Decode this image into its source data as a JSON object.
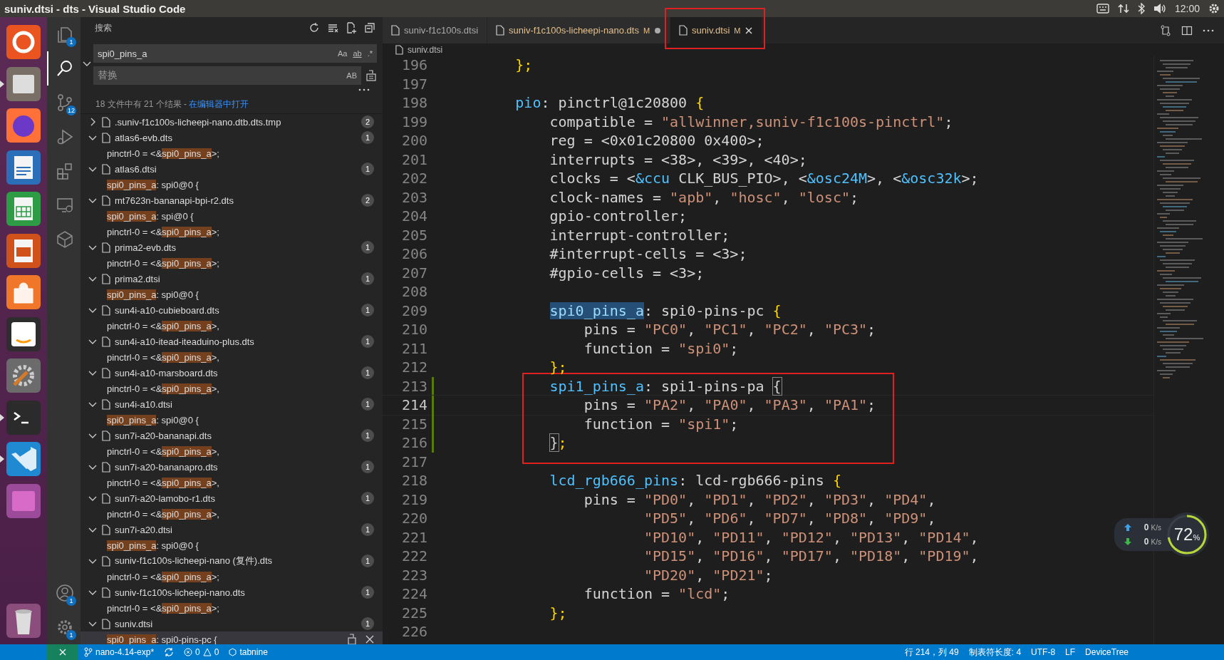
{
  "window": {
    "title": "suniv.dtsi - dts - Visual Studio Code"
  },
  "tray": {
    "time": "12:00"
  },
  "dock": [
    {
      "running": false
    },
    {
      "running": true
    },
    {
      "running": false
    },
    {
      "running": false
    },
    {
      "running": false
    },
    {
      "running": false
    },
    {
      "running": false
    },
    {
      "running": false
    },
    {
      "running": false
    },
    {
      "running": true
    },
    {
      "running": true
    },
    {
      "running": false
    }
  ],
  "activity_bar": [
    {
      "badge": "1",
      "selected": false
    },
    {
      "selected": true
    },
    {
      "badge": "12",
      "selected": false
    },
    {
      "selected": false
    },
    {
      "selected": false
    },
    {
      "selected": false
    },
    {
      "selected": false
    }
  ],
  "activity_bar_bottom": [
    {
      "badge": "1"
    },
    {
      "badge": "1"
    }
  ],
  "sidebar": {
    "title": "搜索",
    "search": {
      "value": "spi0_pins_a",
      "options": [
        "Aa",
        "ab",
        ".*"
      ]
    },
    "replace": {
      "placeholder": "替换",
      "options": [
        "AB"
      ]
    },
    "summary": "18 文件中有 21 个结果 - ",
    "summary_link": "在编辑器中打开",
    "files": [
      {
        "name": ".suniv-f1c100s-licheepi-nano.dtb.dts.tmp",
        "count": "2",
        "expanded": false
      },
      {
        "name": "atlas6-evb.dts",
        "count": "1",
        "expanded": true,
        "matches": [
          {
            "before": "pinctrl-0 = <&",
            "match": "spi0_pins_a",
            "after": ">;",
            "selected": false
          }
        ]
      },
      {
        "name": "atlas6.dtsi",
        "count": "1",
        "expanded": true,
        "matches": [
          {
            "match": "spi0_pins_a",
            "after": ": spi0@0 {",
            "selected": false
          }
        ]
      },
      {
        "name": "mt7623n-bananapi-bpi-r2.dts",
        "count": "2",
        "expanded": true,
        "matches": [
          {
            "match": "spi0_pins_a",
            "after": ": spi@0 {",
            "selected": false
          },
          {
            "before": "pinctrl-0 = <&",
            "match": "spi0_pins_a",
            "after": ">;",
            "selected": false
          }
        ]
      },
      {
        "name": "prima2-evb.dts",
        "count": "1",
        "expanded": true,
        "matches": [
          {
            "before": "pinctrl-0 = <&",
            "match": "spi0_pins_a",
            "after": ">;",
            "selected": false
          }
        ]
      },
      {
        "name": "prima2.dtsi",
        "count": "1",
        "expanded": true,
        "matches": [
          {
            "match": "spi0_pins_a",
            "after": ": spi0@0 {",
            "selected": false
          }
        ]
      },
      {
        "name": "sun4i-a10-cubieboard.dts",
        "count": "1",
        "expanded": true,
        "matches": [
          {
            "before": "pinctrl-0 = <&",
            "match": "spi0_pins_a",
            "after": ">,",
            "selected": false
          }
        ]
      },
      {
        "name": "sun4i-a10-itead-iteaduino-plus.dts",
        "count": "1",
        "expanded": true,
        "matches": [
          {
            "before": "pinctrl-0 = <&",
            "match": "spi0_pins_a",
            "after": ">,",
            "selected": false
          }
        ]
      },
      {
        "name": "sun4i-a10-marsboard.dts",
        "count": "1",
        "expanded": true,
        "matches": [
          {
            "before": "pinctrl-0 = <&",
            "match": "spi0_pins_a",
            "after": ">,",
            "selected": false
          }
        ]
      },
      {
        "name": "sun4i-a10.dtsi",
        "count": "1",
        "expanded": true,
        "matches": [
          {
            "match": "spi0_pins_a",
            "after": ": spi0@0 {",
            "selected": false
          }
        ]
      },
      {
        "name": "sun7i-a20-bananapi.dts",
        "count": "1",
        "expanded": true,
        "matches": [
          {
            "before": "pinctrl-0 = <&",
            "match": "spi0_pins_a",
            "after": ">,",
            "selected": false
          }
        ]
      },
      {
        "name": "sun7i-a20-bananapro.dts",
        "count": "1",
        "expanded": true,
        "matches": [
          {
            "before": "pinctrl-0 = <&",
            "match": "spi0_pins_a",
            "after": ">,",
            "selected": false
          }
        ]
      },
      {
        "name": "sun7i-a20-lamobo-r1.dts",
        "count": "1",
        "expanded": true,
        "matches": [
          {
            "before": "pinctrl-0 = <&",
            "match": "spi0_pins_a",
            "after": ">,",
            "selected": false
          }
        ]
      },
      {
        "name": "sun7i-a20.dtsi",
        "count": "1",
        "expanded": true,
        "matches": [
          {
            "match": "spi0_pins_a",
            "after": ": spi0@0 {",
            "selected": false
          }
        ]
      },
      {
        "name": "suniv-f1c100s-licheepi-nano (复件).dts",
        "count": "1",
        "expanded": true,
        "matches": [
          {
            "before": "pinctrl-0 = <&",
            "match": "spi0_pins_a",
            "after": ">;",
            "selected": false
          }
        ]
      },
      {
        "name": "suniv-f1c100s-licheepi-nano.dts",
        "count": "1",
        "expanded": true,
        "matches": [
          {
            "before": "pinctrl-0 = <&",
            "match": "spi0_pins_a",
            "after": ">;",
            "selected": false
          }
        ]
      },
      {
        "name": "suniv.dtsi",
        "count": "1",
        "expanded": true,
        "matches": [
          {
            "match": "spi0_pins_a",
            "after": ": spi0-pins-pc {",
            "selected": true
          }
        ]
      }
    ]
  },
  "tabs": [
    {
      "label": "suniv-f1c100s.dtsi",
      "selected": false,
      "dirty": false,
      "boxed": false
    },
    {
      "label": "suniv-f1c100s-licheepi-nano.dts",
      "git": "M",
      "selected": false,
      "dirty": true,
      "boxed": false
    },
    {
      "label": "suniv.dtsi",
      "git": "M",
      "selected": true,
      "dirty": false,
      "boxed": true
    }
  ],
  "breadcrumb": "suniv.dtsi",
  "code": [
    {
      "number": "196",
      "tokens": [
        {
          "text": "        };",
          "kind": "brace"
        }
      ]
    },
    {
      "number": "197"
    },
    {
      "number": "198",
      "tokens": [
        {
          "text": "        pio",
          "kind": "label"
        },
        {
          "text": ": pinctrl@1c20800 ",
          "kind": "text"
        },
        {
          "text": "{",
          "kind": "brace"
        }
      ]
    },
    {
      "number": "199",
      "tokens": [
        {
          "text": "            compatible = ",
          "kind": "text"
        },
        {
          "text": "\"allwinner,suniv-f1c100s-pinctrl\"",
          "kind": "string"
        },
        {
          "text": ";",
          "kind": "text"
        }
      ]
    },
    {
      "number": "200",
      "tokens": [
        {
          "text": "            reg = <0x01c20800 0x400>;",
          "kind": "text"
        }
      ]
    },
    {
      "number": "201",
      "tokens": [
        {
          "text": "            interrupts = <38>, <39>, <40>;",
          "kind": "text"
        }
      ]
    },
    {
      "number": "202",
      "tokens": [
        {
          "text": "            clocks = <",
          "kind": "text"
        },
        {
          "text": "&ccu",
          "kind": "ref"
        },
        {
          "text": " CLK_BUS_PIO>, <",
          "kind": "text"
        },
        {
          "text": "&osc24M",
          "kind": "ref"
        },
        {
          "text": ">, <",
          "kind": "text"
        },
        {
          "text": "&osc32k",
          "kind": "ref"
        },
        {
          "text": ">;",
          "kind": "text"
        }
      ]
    },
    {
      "number": "203",
      "tokens": [
        {
          "text": "            clock-names = ",
          "kind": "text"
        },
        {
          "text": "\"apb\"",
          "kind": "string"
        },
        {
          "text": ", ",
          "kind": "text"
        },
        {
          "text": "\"hosc\"",
          "kind": "string"
        },
        {
          "text": ", ",
          "kind": "text"
        },
        {
          "text": "\"losc\"",
          "kind": "string"
        },
        {
          "text": ";",
          "kind": "text"
        }
      ]
    },
    {
      "number": "204",
      "tokens": [
        {
          "text": "            gpio-controller;",
          "kind": "text"
        }
      ]
    },
    {
      "number": "205",
      "tokens": [
        {
          "text": "            interrupt-controller;",
          "kind": "text"
        }
      ]
    },
    {
      "number": "206",
      "tokens": [
        {
          "text": "            #interrupt-cells = <3>;",
          "kind": "text"
        }
      ]
    },
    {
      "number": "207",
      "tokens": [
        {
          "text": "            #gpio-cells = <3>;",
          "kind": "text"
        }
      ]
    },
    {
      "number": "208"
    },
    {
      "number": "209",
      "tokens": [
        {
          "text": "            spi0_pins_a",
          "kind": "match"
        },
        {
          "text": ": spi0-pins-pc ",
          "kind": "text"
        },
        {
          "text": "{",
          "kind": "brace"
        }
      ]
    },
    {
      "number": "210",
      "tokens": [
        {
          "text": "                pins = ",
          "kind": "text"
        },
        {
          "text": "\"PC0\"",
          "kind": "string"
        },
        {
          "text": ", ",
          "kind": "text"
        },
        {
          "text": "\"PC1\"",
          "kind": "string"
        },
        {
          "text": ", ",
          "kind": "text"
        },
        {
          "text": "\"PC2\"",
          "kind": "string"
        },
        {
          "text": ", ",
          "kind": "text"
        },
        {
          "text": "\"PC3\"",
          "kind": "string"
        },
        {
          "text": ";",
          "kind": "text"
        }
      ]
    },
    {
      "number": "211",
      "tokens": [
        {
          "text": "                function = ",
          "kind": "text"
        },
        {
          "text": "\"spi0\"",
          "kind": "string"
        },
        {
          "text": ";",
          "kind": "text"
        }
      ]
    },
    {
      "number": "212",
      "tokens": [
        {
          "text": "            };",
          "kind": "brace"
        }
      ]
    },
    {
      "number": "213",
      "modified": true,
      "boxed": true,
      "tokens": [
        {
          "text": "            spi1_pins_a",
          "kind": "label"
        },
        {
          "text": ": spi1-pins-pa ",
          "kind": "text"
        },
        {
          "text": "{",
          "kind": "bracket-match"
        }
      ]
    },
    {
      "number": "214",
      "modified": true,
      "boxed": true,
      "current": true,
      "tokens": [
        {
          "text": "                pins = ",
          "kind": "text"
        },
        {
          "text": "\"PA2\"",
          "kind": "string"
        },
        {
          "text": ", ",
          "kind": "text"
        },
        {
          "text": "\"PA0\"",
          "kind": "string"
        },
        {
          "text": ", ",
          "kind": "text"
        },
        {
          "text": "\"PA3\"",
          "kind": "string"
        },
        {
          "text": ", ",
          "kind": "text"
        },
        {
          "text": "\"PA1\"",
          "kind": "string"
        },
        {
          "text": ";",
          "kind": "text"
        }
      ]
    },
    {
      "number": "215",
      "modified": true,
      "boxed": true,
      "tokens": [
        {
          "text": "                function = ",
          "kind": "text"
        },
        {
          "text": "\"spi1\"",
          "kind": "string"
        },
        {
          "text": ";",
          "kind": "text"
        }
      ]
    },
    {
      "number": "216",
      "modified": true,
      "boxed": true,
      "tokens": [
        {
          "text": "            }",
          "kind": "bracket-match"
        },
        {
          "text": ";",
          "kind": "brace"
        }
      ]
    },
    {
      "number": "217",
      "boxed": true
    },
    {
      "number": "218",
      "tokens": [
        {
          "text": "            lcd_rgb666_pins",
          "kind": "label"
        },
        {
          "text": ": lcd-rgb666-pins ",
          "kind": "text"
        },
        {
          "text": "{",
          "kind": "brace"
        }
      ]
    },
    {
      "number": "219",
      "tokens": [
        {
          "text": "                pins = ",
          "kind": "text"
        },
        {
          "text": "\"PD0\"",
          "kind": "string"
        },
        {
          "text": ", ",
          "kind": "text"
        },
        {
          "text": "\"PD1\"",
          "kind": "string"
        },
        {
          "text": ", ",
          "kind": "text"
        },
        {
          "text": "\"PD2\"",
          "kind": "string"
        },
        {
          "text": ", ",
          "kind": "text"
        },
        {
          "text": "\"PD3\"",
          "kind": "string"
        },
        {
          "text": ", ",
          "kind": "text"
        },
        {
          "text": "\"PD4\"",
          "kind": "string"
        },
        {
          "text": ",",
          "kind": "text"
        }
      ]
    },
    {
      "number": "220",
      "tokens": [
        {
          "text": "                       \"PD5\"",
          "kind": "string"
        },
        {
          "text": ", ",
          "kind": "text"
        },
        {
          "text": "\"PD6\"",
          "kind": "string"
        },
        {
          "text": ", ",
          "kind": "text"
        },
        {
          "text": "\"PD7\"",
          "kind": "string"
        },
        {
          "text": ", ",
          "kind": "text"
        },
        {
          "text": "\"PD8\"",
          "kind": "string"
        },
        {
          "text": ", ",
          "kind": "text"
        },
        {
          "text": "\"PD9\"",
          "kind": "string"
        },
        {
          "text": ",",
          "kind": "text"
        }
      ]
    },
    {
      "number": "221",
      "tokens": [
        {
          "text": "                       \"PD10\"",
          "kind": "string"
        },
        {
          "text": ", ",
          "kind": "text"
        },
        {
          "text": "\"PD11\"",
          "kind": "string"
        },
        {
          "text": ", ",
          "kind": "text"
        },
        {
          "text": "\"PD12\"",
          "kind": "string"
        },
        {
          "text": ", ",
          "kind": "text"
        },
        {
          "text": "\"PD13\"",
          "kind": "string"
        },
        {
          "text": ", ",
          "kind": "text"
        },
        {
          "text": "\"PD14\"",
          "kind": "string"
        },
        {
          "text": ",",
          "kind": "text"
        }
      ]
    },
    {
      "number": "222",
      "tokens": [
        {
          "text": "                       \"PD15\"",
          "kind": "string"
        },
        {
          "text": ", ",
          "kind": "text"
        },
        {
          "text": "\"PD16\"",
          "kind": "string"
        },
        {
          "text": ", ",
          "kind": "text"
        },
        {
          "text": "\"PD17\"",
          "kind": "string"
        },
        {
          "text": ", ",
          "kind": "text"
        },
        {
          "text": "\"PD18\"",
          "kind": "string"
        },
        {
          "text": ", ",
          "kind": "text"
        },
        {
          "text": "\"PD19\"",
          "kind": "string"
        },
        {
          "text": ",",
          "kind": "text"
        }
      ]
    },
    {
      "number": "223",
      "tokens": [
        {
          "text": "                       \"PD20\"",
          "kind": "string"
        },
        {
          "text": ", ",
          "kind": "text"
        },
        {
          "text": "\"PD21\"",
          "kind": "string"
        },
        {
          "text": ";",
          "kind": "text"
        }
      ]
    },
    {
      "number": "224",
      "tokens": [
        {
          "text": "                function = ",
          "kind": "text"
        },
        {
          "text": "\"lcd\"",
          "kind": "string"
        },
        {
          "text": ";",
          "kind": "text"
        }
      ]
    },
    {
      "number": "225",
      "tokens": [
        {
          "text": "            };",
          "kind": "brace"
        }
      ]
    },
    {
      "number": "226"
    }
  ],
  "net_widget": {
    "up": "0",
    "down": "0",
    "unit_up": "K/s",
    "unit_down": "K/s",
    "percent": "72",
    "percent_sign": "%",
    "level": 0.72
  },
  "status_bar": {
    "branch": "nano-4.14-exp*",
    "errors": "0",
    "warnings": "0",
    "tabnine": "tabnine",
    "right": [
      "行 214，列 49",
      "制表符长度: 4",
      "UTF-8",
      "LF",
      "DeviceTree"
    ]
  }
}
